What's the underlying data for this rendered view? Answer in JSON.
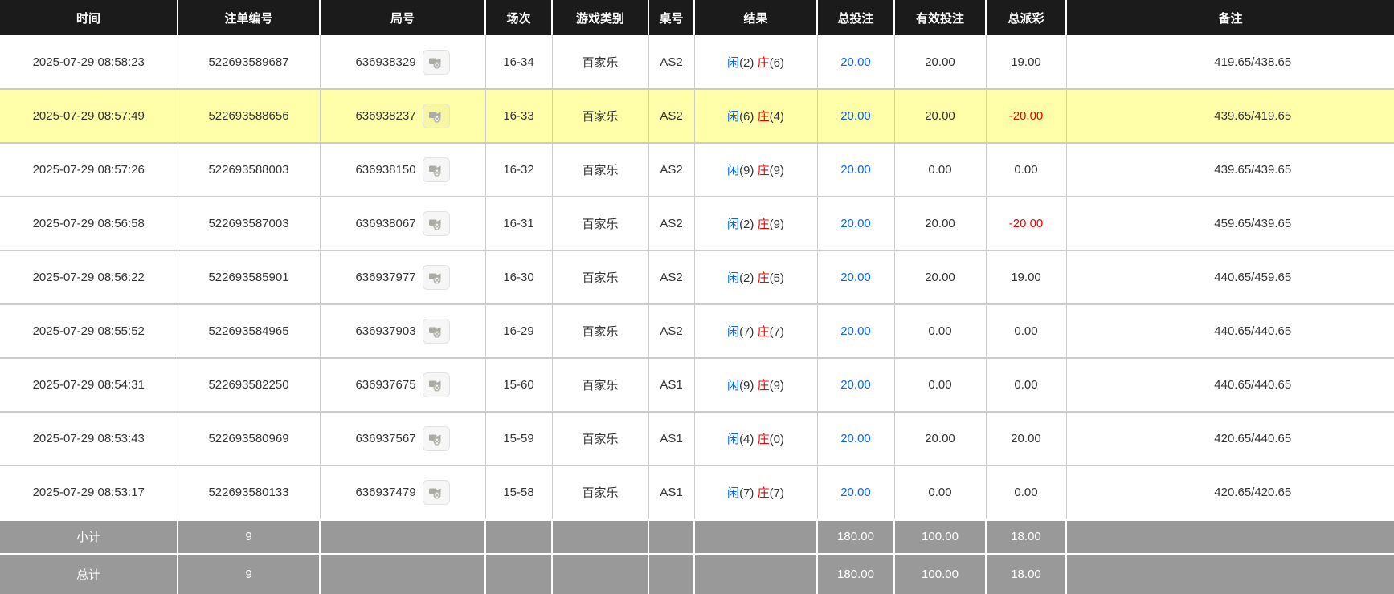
{
  "colors": {
    "header_bg": "#1b1b1b",
    "highlight": "#ffffaa",
    "footer_bg": "#999999",
    "blue": "#0a66f0",
    "red": "#f00000",
    "border": "#cccccc",
    "text": "#333333"
  },
  "columns": [
    {
      "id": "time",
      "label": "时间"
    },
    {
      "id": "bet_id",
      "label": "注单编号"
    },
    {
      "id": "round",
      "label": "局号"
    },
    {
      "id": "session",
      "label": "场次"
    },
    {
      "id": "game",
      "label": "游戏类别"
    },
    {
      "id": "table",
      "label": "桌号"
    },
    {
      "id": "result",
      "label": "结果"
    },
    {
      "id": "total_bet",
      "label": "总投注"
    },
    {
      "id": "valid_bet",
      "label": "有效投注"
    },
    {
      "id": "payout",
      "label": "总派彩"
    },
    {
      "id": "remark",
      "label": "备注"
    }
  ],
  "icons": {
    "round_button": "video-replay-icon"
  },
  "rows": [
    {
      "time": "2025-07-29 08:58:23",
      "bet_id": "522693589687",
      "round": "636938329",
      "session": "16-34",
      "game": "百家乐",
      "table": "AS2",
      "result": {
        "p_label": "闲",
        "p_num": "(2)",
        "b_label": "庄",
        "b_num": "(6)"
      },
      "total_bet": "20.00",
      "valid_bet": "20.00",
      "payout": "19.00",
      "remark": "419.65/438.65",
      "highlight": false
    },
    {
      "time": "2025-07-29 08:57:49",
      "bet_id": "522693588656",
      "round": "636938237",
      "session": "16-33",
      "game": "百家乐",
      "table": "AS2",
      "result": {
        "p_label": "闲",
        "p_num": "(6)",
        "b_label": "庄",
        "b_num": "(4)"
      },
      "total_bet": "20.00",
      "valid_bet": "20.00",
      "payout": "-20.00",
      "remark": "439.65/419.65",
      "highlight": true
    },
    {
      "time": "2025-07-29 08:57:26",
      "bet_id": "522693588003",
      "round": "636938150",
      "session": "16-32",
      "game": "百家乐",
      "table": "AS2",
      "result": {
        "p_label": "闲",
        "p_num": "(9)",
        "b_label": "庄",
        "b_num": "(9)"
      },
      "total_bet": "20.00",
      "valid_bet": "0.00",
      "payout": "0.00",
      "remark": "439.65/439.65",
      "highlight": false
    },
    {
      "time": "2025-07-29 08:56:58",
      "bet_id": "522693587003",
      "round": "636938067",
      "session": "16-31",
      "game": "百家乐",
      "table": "AS2",
      "result": {
        "p_label": "闲",
        "p_num": "(2)",
        "b_label": "庄",
        "b_num": "(9)"
      },
      "total_bet": "20.00",
      "valid_bet": "20.00",
      "payout": "-20.00",
      "remark": "459.65/439.65",
      "highlight": false
    },
    {
      "time": "2025-07-29 08:56:22",
      "bet_id": "522693585901",
      "round": "636937977",
      "session": "16-30",
      "game": "百家乐",
      "table": "AS2",
      "result": {
        "p_label": "闲",
        "p_num": "(2)",
        "b_label": "庄",
        "b_num": "(5)"
      },
      "total_bet": "20.00",
      "valid_bet": "20.00",
      "payout": "19.00",
      "remark": "440.65/459.65",
      "highlight": false
    },
    {
      "time": "2025-07-29 08:55:52",
      "bet_id": "522693584965",
      "round": "636937903",
      "session": "16-29",
      "game": "百家乐",
      "table": "AS2",
      "result": {
        "p_label": "闲",
        "p_num": "(7)",
        "b_label": "庄",
        "b_num": "(7)"
      },
      "total_bet": "20.00",
      "valid_bet": "0.00",
      "payout": "0.00",
      "remark": "440.65/440.65",
      "highlight": false
    },
    {
      "time": "2025-07-29 08:54:31",
      "bet_id": "522693582250",
      "round": "636937675",
      "session": "15-60",
      "game": "百家乐",
      "table": "AS1",
      "result": {
        "p_label": "闲",
        "p_num": "(9)",
        "b_label": "庄",
        "b_num": "(9)"
      },
      "total_bet": "20.00",
      "valid_bet": "0.00",
      "payout": "0.00",
      "remark": "440.65/440.65",
      "highlight": false
    },
    {
      "time": "2025-07-29 08:53:43",
      "bet_id": "522693580969",
      "round": "636937567",
      "session": "15-59",
      "game": "百家乐",
      "table": "AS1",
      "result": {
        "p_label": "闲",
        "p_num": "(4)",
        "b_label": "庄",
        "b_num": "(0)"
      },
      "total_bet": "20.00",
      "valid_bet": "20.00",
      "payout": "20.00",
      "remark": "420.65/440.65",
      "highlight": false
    },
    {
      "time": "2025-07-29 08:53:17",
      "bet_id": "522693580133",
      "round": "636937479",
      "session": "15-58",
      "game": "百家乐",
      "table": "AS1",
      "result": {
        "p_label": "闲",
        "p_num": "(7)",
        "b_label": "庄",
        "b_num": "(7)"
      },
      "total_bet": "20.00",
      "valid_bet": "0.00",
      "payout": "0.00",
      "remark": "420.65/420.65",
      "highlight": false
    }
  ],
  "footer": {
    "subtotal": {
      "label": "小计",
      "count": "9",
      "total_bet": "180.00",
      "valid_bet": "100.00",
      "payout": "18.00"
    },
    "total": {
      "label": "总计",
      "count": "9",
      "total_bet": "180.00",
      "valid_bet": "100.00",
      "payout": "18.00"
    }
  }
}
